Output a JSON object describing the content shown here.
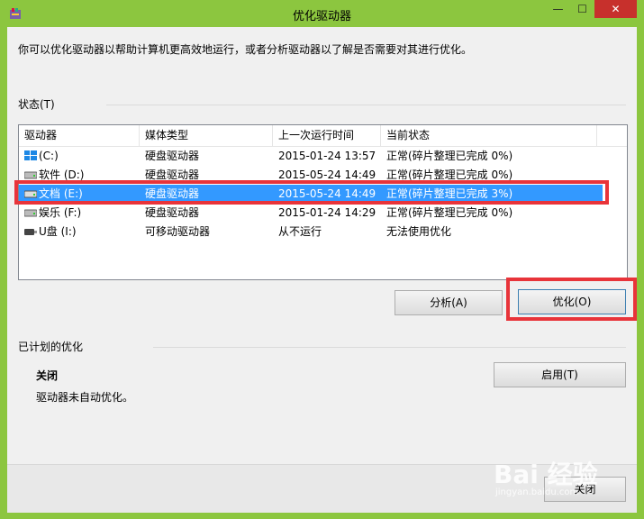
{
  "window": {
    "title": "优化驱动器"
  },
  "description": "你可以优化驱动器以帮助计算机更高效地运行，或者分析驱动器以了解是否需要对其进行优化。",
  "status_section": {
    "label": "状态(T)"
  },
  "drives_table": {
    "columns": [
      "驱动器",
      "媒体类型",
      "上一次运行时间",
      "当前状态"
    ],
    "rows": [
      {
        "drive": "(C:)",
        "media": "硬盘驱动器",
        "last_run": "2015-01-24 13:57",
        "status": "正常(碎片整理已完成 0%)",
        "icon": "windows-drive-icon"
      },
      {
        "drive": "软件 (D:)",
        "media": "硬盘驱动器",
        "last_run": "2015-05-24 14:49",
        "status": "正常(碎片整理已完成 0%)",
        "icon": "hard-drive-icon"
      },
      {
        "drive": "文档 (E:)",
        "media": "硬盘驱动器",
        "last_run": "2015-05-24 14:49",
        "status": "正常(碎片整理已完成 3%)",
        "icon": "hard-drive-icon",
        "selected": true
      },
      {
        "drive": "娱乐 (F:)",
        "media": "硬盘驱动器",
        "last_run": "2015-01-24 14:29",
        "status": "正常(碎片整理已完成 0%)",
        "icon": "hard-drive-icon"
      },
      {
        "drive": "U盘 (I:)",
        "media": "可移动驱动器",
        "last_run": "从不运行",
        "status": "无法使用优化",
        "icon": "usb-drive-icon"
      }
    ]
  },
  "buttons": {
    "analyze": "分析(A)",
    "optimize": "优化(O)",
    "enable": "启用(T)",
    "close": "关闭"
  },
  "scheduled": {
    "label": "已计划的优化",
    "state": "关闭",
    "detail": "驱动器未自动优化。"
  },
  "watermark": {
    "main": "Bai 经验",
    "sub": "jingyan.baidu.com"
  },
  "colors": {
    "frame": "#8cc63f",
    "selection": "#3399ff",
    "highlight_box": "#e8343a",
    "close_button": "#c7302c"
  }
}
